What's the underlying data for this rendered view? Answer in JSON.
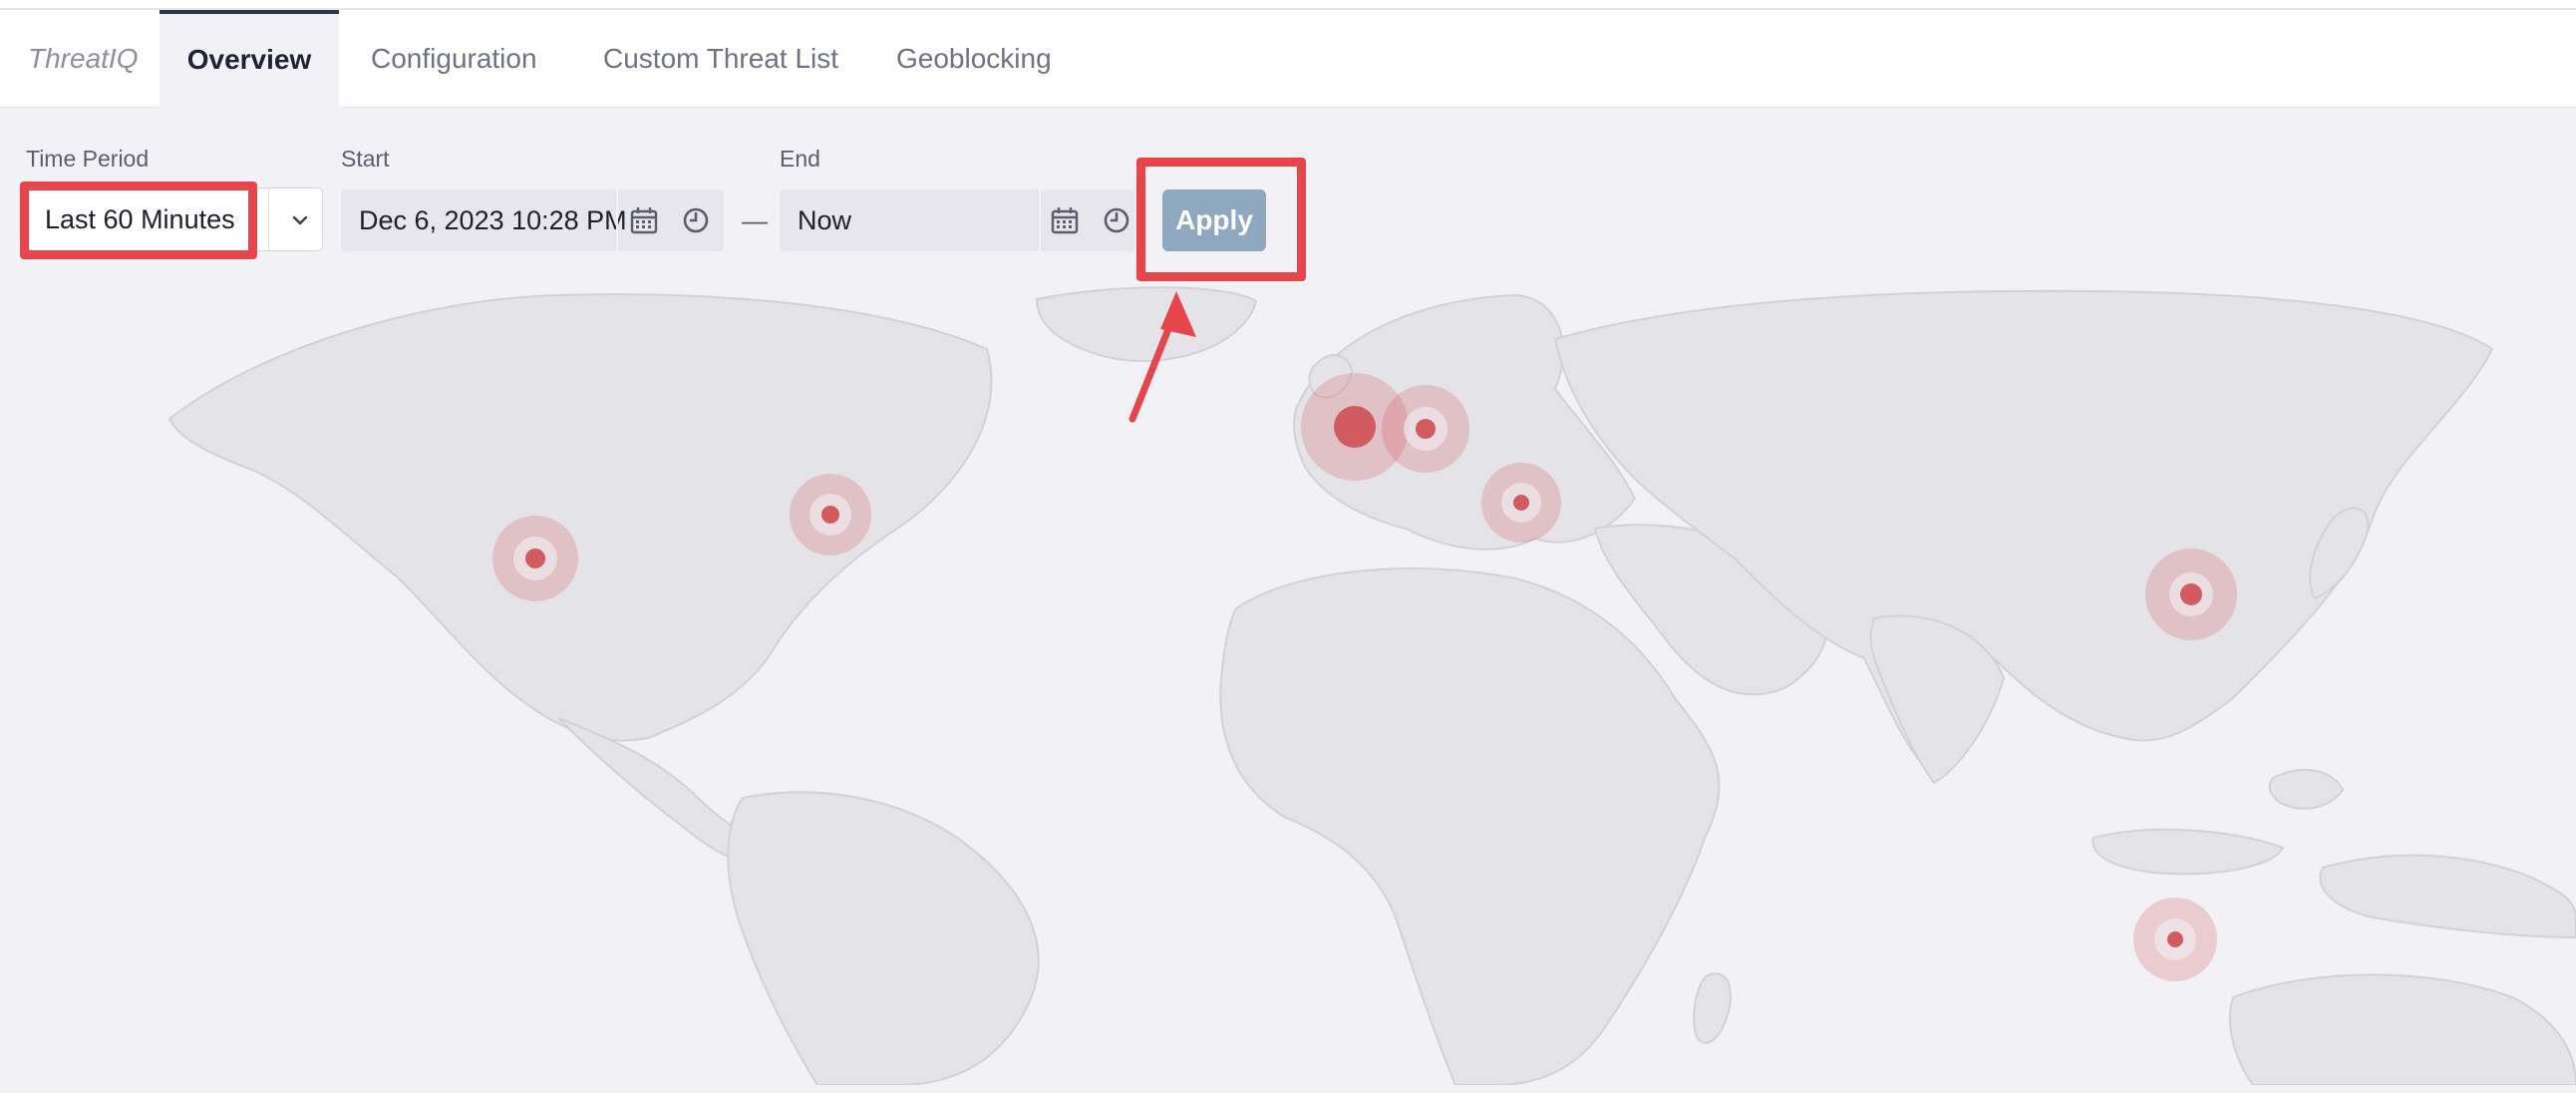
{
  "tabs": {
    "brand": "ThreatIQ",
    "overview": "Overview",
    "configuration": "Configuration",
    "custom_threat_list": "Custom Threat List",
    "geoblocking": "Geoblocking"
  },
  "filters": {
    "time_period_label": "Time Period",
    "time_period_value": "Last 60 Minutes",
    "start_label": "Start",
    "start_value": "Dec 6, 2023 10:28 PM",
    "range_separator": "—",
    "end_label": "End",
    "end_value": "Now",
    "apply_label": "Apply"
  },
  "icons": {
    "dropdown": "chevron-down-icon",
    "calendar": "calendar-icon",
    "clock": "clock-icon",
    "annotation": "arrow-icon"
  },
  "map": {
    "threat_locations": [
      "US West Coast",
      "US East Coast",
      "Western Europe",
      "Central Europe",
      "Balkans",
      "China",
      "Indonesia"
    ]
  },
  "colors": {
    "accent": "#2f3548",
    "apply_button": "#8ea8c0",
    "highlight": "#e5454b",
    "threat_marker": "#d25b5f",
    "land": "#e4e3e8",
    "ocean": "#f2f1f5"
  }
}
